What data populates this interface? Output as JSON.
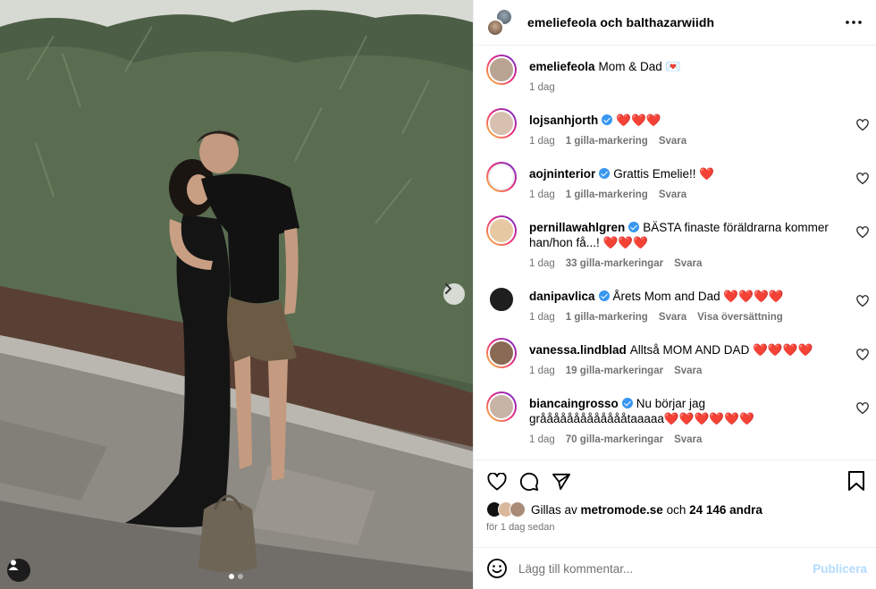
{
  "post": {
    "header": "emeliefeola och balthazarwiidh",
    "image_alt_tag_icon": "person-tag-icon",
    "carousel": {
      "current": 1,
      "total": 2
    }
  },
  "comments": [
    {
      "user": "emeliefeola",
      "verified": false,
      "text": "Mom & Dad 💌",
      "time": "1 dag",
      "likes": "",
      "reply": "",
      "translate": "",
      "avatar_color": "#b9a493",
      "has_heart": false
    },
    {
      "user": "lojsanhjorth",
      "verified": true,
      "text": "❤️❤️❤️",
      "time": "1 dag",
      "likes": "1 gilla-markering",
      "reply": "Svara",
      "translate": "",
      "avatar_color": "#d8c0b0",
      "has_heart": true
    },
    {
      "user": "aojninterior",
      "verified": true,
      "text": "Grattis Emelie!! ❤️",
      "time": "1 dag",
      "likes": "1 gilla-markering",
      "reply": "Svara",
      "translate": "",
      "avatar_color": "#ffffff",
      "has_heart": true
    },
    {
      "user": "pernillawahlgren",
      "verified": true,
      "text": "BÄSTA finaste föräldrarna kommer han/hon få...! ❤️❤️❤️",
      "time": "1 dag",
      "likes": "33 gilla-markeringar",
      "reply": "Svara",
      "translate": "",
      "avatar_color": "#e6c9a3",
      "has_heart": true
    },
    {
      "user": "danipavlica",
      "verified": true,
      "text": "Årets Mom and Dad ❤️❤️❤️❤️",
      "time": "1 dag",
      "likes": "1 gilla-markering",
      "reply": "Svara",
      "translate": "Visa översättning",
      "avatar_color": "#1e1e1e",
      "has_heart": true
    },
    {
      "user": "vanessa.lindblad",
      "verified": false,
      "text": "Alltså MOM AND DAD ❤️❤️❤️❤️",
      "time": "1 dag",
      "likes": "19 gilla-markeringar",
      "reply": "Svara",
      "translate": "",
      "avatar_color": "#8a6a55",
      "has_heart": true
    },
    {
      "user": "biancaingrosso",
      "verified": true,
      "text": "Nu börjar jag gråååååååååååååtaaaaa❤️❤️❤️❤️❤️❤️",
      "time": "1 dag",
      "likes": "70 gilla-markeringar",
      "reply": "Svara",
      "translate": "",
      "avatar_color": "#c8b4a6",
      "has_heart": true
    }
  ],
  "footer": {
    "liked_by_prefix": "Gillas av",
    "liked_by_user": "metromode.se",
    "liked_by_and": "och",
    "liked_by_count": "24 146 andra",
    "time_ago": "för 1 dag sedan",
    "comment_placeholder": "Lägg till kommentar...",
    "publish_label": "Publicera"
  },
  "colors": {
    "accent": "#0095f6",
    "publish_disabled": "#b3dbff",
    "verified": "#3897f0",
    "heart_red": "#ed4956"
  }
}
